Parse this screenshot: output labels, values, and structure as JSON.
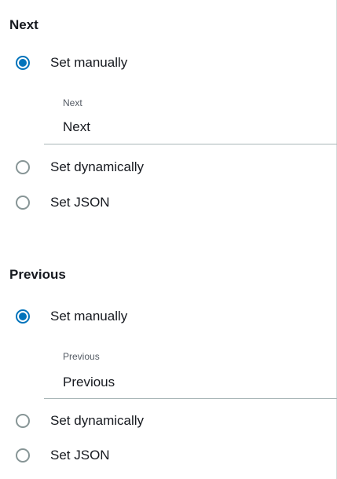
{
  "sections": {
    "next": {
      "title": "Next",
      "options": {
        "manual": "Set manually",
        "dynamic": "Set dynamically",
        "json": "Set JSON"
      },
      "selected": "manual",
      "field": {
        "label": "Next",
        "value": "Next"
      }
    },
    "previous": {
      "title": "Previous",
      "options": {
        "manual": "Set manually",
        "dynamic": "Set dynamically",
        "json": "Set JSON"
      },
      "selected": "manual",
      "field": {
        "label": "Previous",
        "value": "Previous"
      }
    }
  },
  "colors": {
    "accent": "#0073bb",
    "radio_border": "#879596",
    "text": "#16191f",
    "muted_text": "#545b64",
    "divider": "#aab7b8"
  }
}
